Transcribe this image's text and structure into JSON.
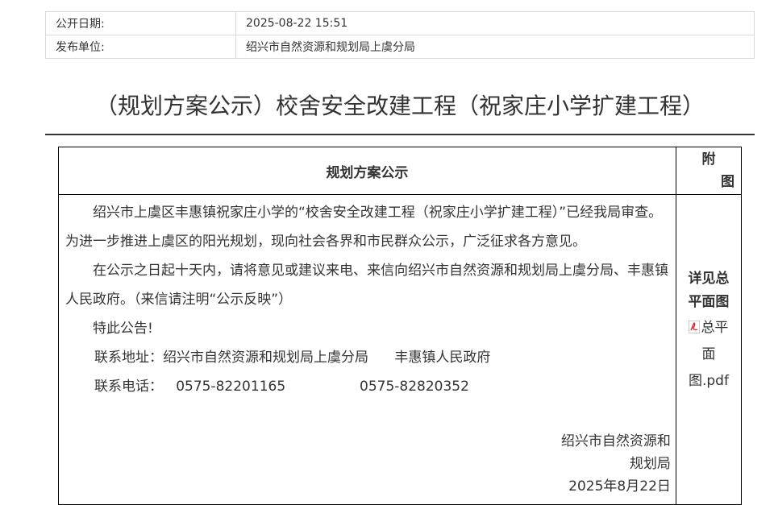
{
  "meta": {
    "date_label": "公开日期:",
    "date_value": "2025-08-22 15:51",
    "unit_label": "发布单位:",
    "unit_value": "绍兴市自然资源和规划局上虞分局"
  },
  "title": "（规划方案公示）校舍安全改建工程（祝家庄小学扩建工程）",
  "table": {
    "header_main": "规划方案公示",
    "header_side_1": "附",
    "header_side_2": "图",
    "paragraph_1": "绍兴市上虞区丰惠镇祝家庄小学的“校舍安全改建工程（祝家庄小学扩建工程）”已经我局审查。为进一步推进上虞区的阳光规划，现向社会各界和市民群众公示，广泛征求各方意见。",
    "paragraph_2": "在公示之日起十天内，请将意见或建议来电、来信向绍兴市自然资源和规划局上虞分局、丰惠镇人民政府。（来信请注明“公示反映”）",
    "paragraph_3": "特此公告!",
    "address_line": "联系地址：绍兴市自然资源和规划局上虞分局      丰惠镇人民政府",
    "phone_line": "联系电话：   0575-82201165                 0575-82820352",
    "sign_org_1": "绍兴市自然资源和",
    "sign_org_2": "规划局",
    "sign_date": "2025年8月22日",
    "side_bold_1": "详见总",
    "side_bold_2": "平面图",
    "side_link_1": "总平",
    "side_link_2": "面",
    "side_link_3": "图.pdf"
  },
  "icons": {
    "attachment": "pdf-icon"
  }
}
